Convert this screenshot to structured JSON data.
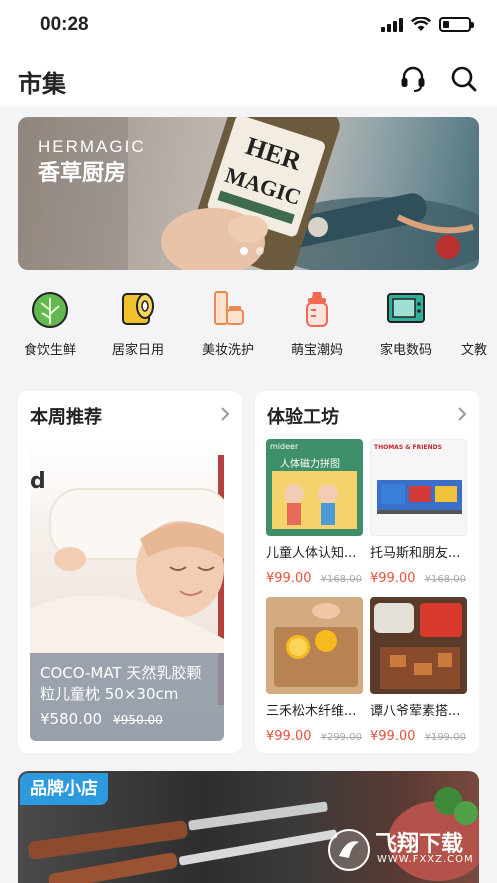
{
  "status_bar": {
    "time": "00:28"
  },
  "header": {
    "title": "市集",
    "support_icon": "headset-icon",
    "search_icon": "search-icon"
  },
  "banner": {
    "brand": "HERMAGIC",
    "subtitle": "香草厨房",
    "slides": 2,
    "active_slide": 1
  },
  "categories": [
    {
      "label": "食饮生鲜",
      "icon": "cabbage-icon",
      "color": "#63b94f"
    },
    {
      "label": "居家日用",
      "icon": "tissue-roll-icon",
      "color": "#f2c12e"
    },
    {
      "label": "美妆洗护",
      "icon": "cosmetics-icon",
      "color": "#e98a4f"
    },
    {
      "label": "萌宝潮妈",
      "icon": "baby-bottle-icon",
      "color": "#ef6a4f"
    },
    {
      "label": "家电数码",
      "icon": "tv-icon",
      "color": "#2fae9a"
    },
    {
      "label": "文教",
      "icon": "pencil-icon",
      "color": "#3a8fd6"
    }
  ],
  "weekly": {
    "title": "本周推荐",
    "feature_letter": "d",
    "feature": {
      "name": "COCO-MAT 天然乳胶颗粒儿童枕 50×30cm",
      "price": "¥580.00",
      "original": "¥950.00"
    }
  },
  "workshop": {
    "title": "体验工坊",
    "products": [
      {
        "name": "儿童人体认知...",
        "price": "¥99.00",
        "original": "¥168.00"
      },
      {
        "name": "托马斯和朋友...",
        "price": "¥99.00",
        "original": "¥168.00"
      },
      {
        "name": "三禾松木纤维...",
        "price": "¥99.00",
        "original": "¥299.00"
      },
      {
        "name": "谭八爷荤素搭...",
        "price": "¥99.00",
        "original": "¥199.00"
      }
    ],
    "product_labels": {
      "mideer": "mideer",
      "puzzle": "人体磁力拼图",
      "thomas": "THOMAS & FRIENDS"
    }
  },
  "brand_store": {
    "label": "品牌小店"
  },
  "watermark": {
    "text": "飞翔下载",
    "url": "WWW.FXXZ.COM"
  },
  "colors": {
    "accent_blue": "#2d9ae0",
    "price_red": "#e6513e"
  }
}
